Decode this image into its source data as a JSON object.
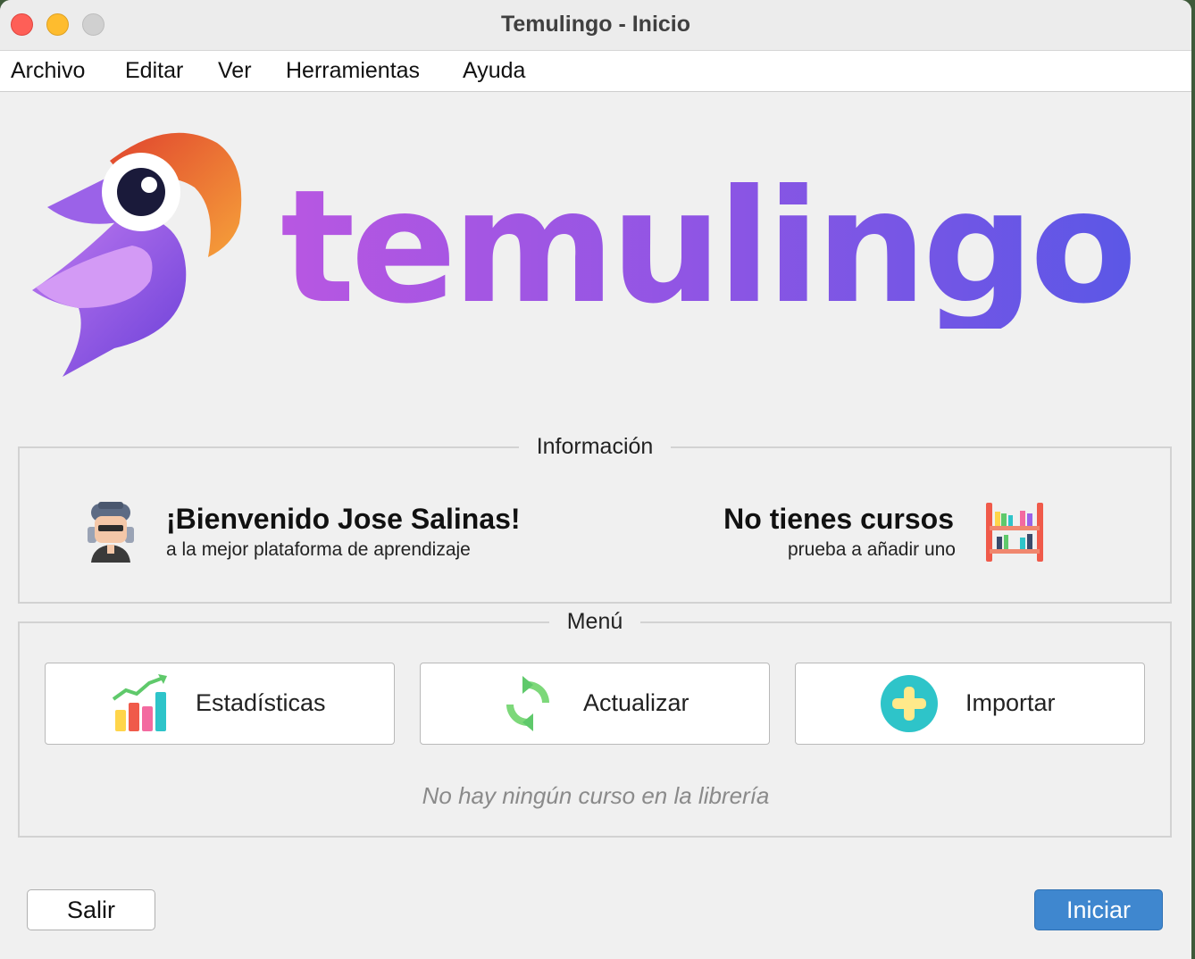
{
  "window": {
    "title": "Temulingo - Inicio"
  },
  "menubar": {
    "items": [
      "Archivo",
      "Editar",
      "Ver",
      "Herramientas",
      "Ayuda"
    ]
  },
  "brand": {
    "wordmark": "temulingo",
    "colors": {
      "purple": "#9b5ce6",
      "orange": "#f07a2d",
      "accent": "#3f87cf"
    }
  },
  "info": {
    "legend": "Información",
    "welcome_title": "¡Bienvenido Jose Salinas!",
    "welcome_sub": "a la mejor plataforma de aprendizaje",
    "courses_title": "No tienes cursos",
    "courses_sub": "prueba a añadir uno",
    "icons": [
      "avatar-icon",
      "bookshelf-icon"
    ]
  },
  "menu": {
    "legend": "Menú",
    "buttons": [
      {
        "label": "Estadísticas",
        "icon": "bar-chart-icon"
      },
      {
        "label": "Actualizar",
        "icon": "refresh-icon"
      },
      {
        "label": "Importar",
        "icon": "plus-circle-icon"
      }
    ],
    "empty_message": "No hay ningún curso en la librería"
  },
  "footer": {
    "exit_label": "Salir",
    "start_label": "Iniciar"
  }
}
